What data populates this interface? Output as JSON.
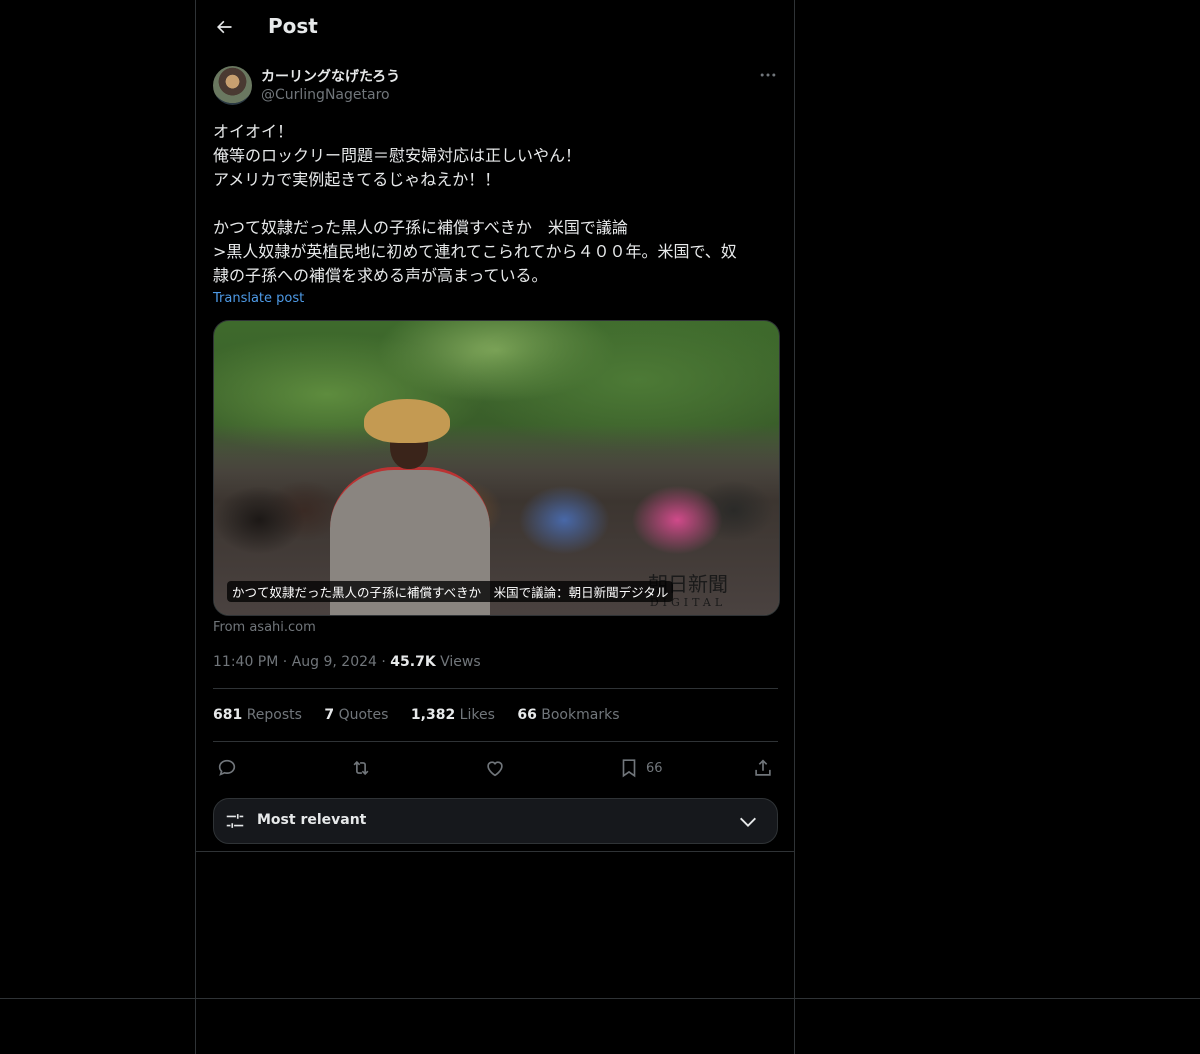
{
  "header": {
    "title": "Post"
  },
  "author": {
    "name": "カーリングなげたろう",
    "handle": "@CurlingNagetaro"
  },
  "post": {
    "lines": [
      "オイオイ！",
      "俺等のロックリー問題＝慰安婦対応は正しいやん！",
      "アメリカで実例起きてるじゃねえか！！",
      "",
      "かつて奴隷だった黒人の子孫に補償すべきか　米国で議論",
      ">黒人奴隷が英植民地に初めて連れてこられてから４００年。米国で、奴",
      "隷の子孫への補償を求める声が高まっている。"
    ],
    "translate_label": "Translate post"
  },
  "card": {
    "caption": "かつて奴隷だった黒人の子孫に補償すべきか　米国で議論：朝日新聞デジタル",
    "logo_text": "朝日新聞",
    "logo_sub": "DIGITAL",
    "source": "From asahi.com"
  },
  "meta": {
    "time": "11:40 PM",
    "dot1": "·",
    "date": "Aug 9, 2024",
    "dot2": "·",
    "views_count": "45.7K",
    "views_label": "Views"
  },
  "stats": {
    "reposts_count": "681",
    "reposts_label": "Repots",
    "quotes_count": "7",
    "quotes_label": "Quotes",
    "likes_count": "1,382",
    "likes_label": "Likes",
    "bookmarks_count": "66",
    "bookmarks_label": "Bookmarks"
  },
  "actions": {
    "bookmark_count": "66"
  },
  "sort": {
    "label": "Most relevant"
  },
  "colors": {
    "background": "#000000",
    "border": "#2f3336",
    "text": "#e7e9ea",
    "muted": "#71767b",
    "link": "#4e9ae6"
  },
  "icons": [
    "back-arrow-icon",
    "more-icon",
    "reply-icon",
    "repost-icon",
    "like-icon",
    "bookmark-icon",
    "share-icon",
    "sliders-icon",
    "chevron-down-icon"
  ]
}
